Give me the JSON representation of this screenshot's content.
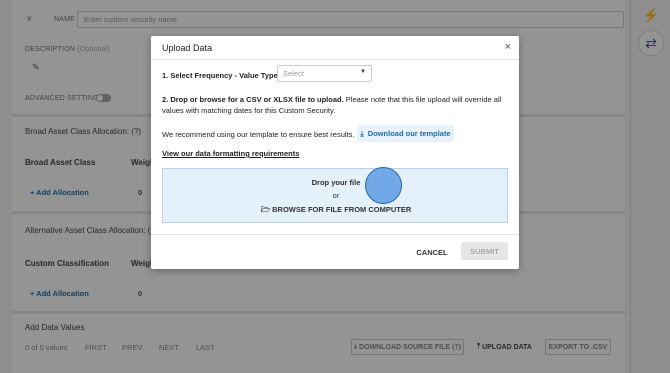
{
  "background": {
    "name_label": "NAME",
    "name_placeholder": "Enter custom security name",
    "description_label": "DESCRIPTION",
    "description_optional": "(Optional)",
    "advanced_settings_label": "ADVANCED SETTINGS",
    "broad_section": {
      "title": "Broad Asset Class Allocation: (?)",
      "col_class": "Broad Asset Class",
      "col_weight": "Weigh",
      "add_allocation": "+ Add Allocation",
      "total": "0"
    },
    "alt_section": {
      "title": "Alternative Asset Class Allocation: (?)",
      "col_class": "Custom Classification",
      "col_weight": "Weigh",
      "add_allocation": "+ Add Allocation",
      "total": "0"
    },
    "data_values": {
      "title": "Add Data Values",
      "count": "0 of 0 values",
      "first": "FIRST",
      "prev": "PREV",
      "next": "NEXT",
      "last": "LAST",
      "download_source": "DOWNLOAD SOURCE FILE (?)",
      "upload_data": "UPLOAD DATA",
      "export_csv": "EXPORT TO .CSV"
    }
  },
  "modal": {
    "title": "Upload Data",
    "close": "×",
    "step1_label": "1. Select Frequency - Value Type",
    "select_placeholder": "Select",
    "step2_bold": "2. Drop or browse for a CSV or XLSX file to upload.",
    "step2_rest": "Please note that this file upload will override all values with matching dates for this Custom Security.",
    "template_text": "We recommend using our template to ensure best results.",
    "template_button": "Download our template",
    "requirements_link": "View our data formatting requirements",
    "dropzone_line1": "Drop your file",
    "dropzone_or": "or",
    "dropzone_browse": "BROWSE FOR FILE FROM COMPUTER",
    "cancel": "CANCEL",
    "submit": "SUBMIT"
  }
}
